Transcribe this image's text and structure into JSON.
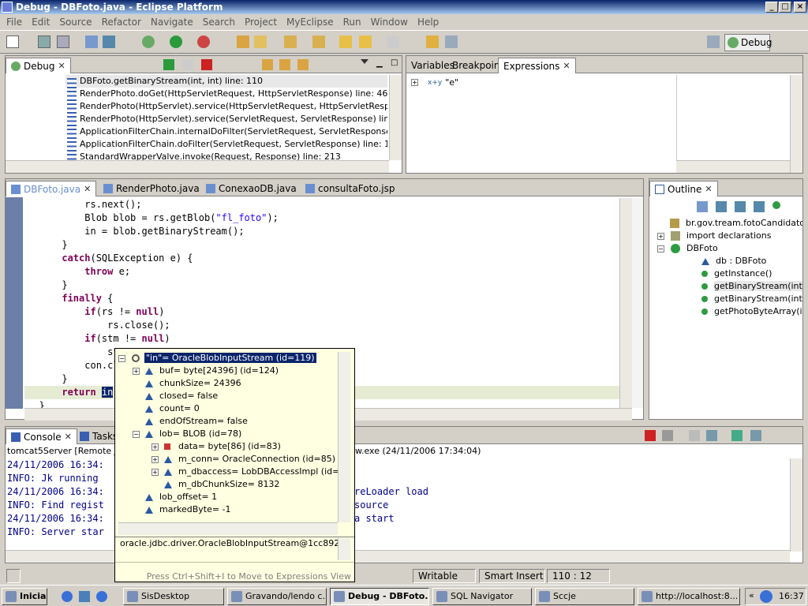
{
  "window": {
    "title": "Debug - DBFoto.java - Eclipse Platform"
  },
  "menu": [
    "File",
    "Edit",
    "Source",
    "Refactor",
    "Navigate",
    "Search",
    "Project",
    "MyEclipse",
    "Run",
    "Window",
    "Help"
  ],
  "perspective": {
    "label": "Debug"
  },
  "debug_view": {
    "tab": "Debug",
    "frames": [
      "DBFoto.getBinaryStream(int, int) line: 110",
      "RenderPhoto.doGet(HttpServletRequest, HttpServletResponse) line: 46",
      "RenderPhoto(HttpServlet).service(HttpServletRequest, HttpServletResponse) line",
      "RenderPhoto(HttpServlet).service(ServletRequest, ServletResponse) line: 802",
      "ApplicationFilterChain.internalDoFilter(ServletRequest, ServletResponse) line: 25",
      "ApplicationFilterChain.doFilter(ServletRequest, ServletResponse) line: 173",
      "StandardWrapperValve.invoke(Request, Response) line: 213"
    ]
  },
  "vars_view": {
    "tabs": [
      "Variables",
      "Breakpoints",
      "Expressions"
    ],
    "expression_icon": "x+y",
    "expression": "\"e\""
  },
  "editor": {
    "tabs": [
      "DBFoto.java",
      "RenderPhoto.java",
      "ConexaoDB.java",
      "consultaFoto.jsp"
    ],
    "lines": [
      {
        "ind": "        ",
        "txt": "rs.next();"
      },
      {
        "ind": "        ",
        "txt": "Blob blob = rs.getBlob(",
        "s": "\"fl_foto\"",
        "after": ");"
      },
      {
        "ind": "        ",
        "txt": "in = blob.getBinaryStream();"
      },
      {
        "ind": "    ",
        "txt": "}"
      },
      {
        "ind": "    ",
        "k": "catch",
        "after": "(SQLException e) {"
      },
      {
        "ind": "        ",
        "k": "throw",
        "after": " e;"
      },
      {
        "ind": "    ",
        "txt": "}"
      },
      {
        "ind": "    ",
        "k": "finally",
        "after": " {"
      },
      {
        "ind": "        ",
        "k": "if",
        "after": "(rs != ",
        "k2": "null",
        "after2": ")"
      },
      {
        "ind": "            ",
        "txt": "rs.close();"
      },
      {
        "ind": "        ",
        "k": "if",
        "after": "(stm != ",
        "k2": "null",
        "after2": ")"
      },
      {
        "ind": "            ",
        "txt": "st"
      },
      {
        "ind": "        ",
        "txt": "con.cl"
      },
      {
        "ind": "    ",
        "txt": "}"
      },
      {
        "ind": "    ",
        "k": "return",
        "after": " ",
        "sel": "in",
        "after2": ";"
      },
      {
        "ind": "",
        "txt": "}"
      }
    ]
  },
  "outline": {
    "tab": "Outline",
    "items": [
      "br.gov.tream.fotoCandidato.",
      "import declarations",
      "DBFoto",
      "db : DBFoto",
      "getInstance()",
      "getBinaryStream(int, int",
      "getBinaryStream(int)",
      "getPhotoByteArray(int,"
    ]
  },
  "popup": {
    "root": "\"in\"= OracleBlobInputStream  (id=119)",
    "rows": [
      "buf= byte[24396]  (id=124)",
      "chunkSize= 24396",
      "closed= false",
      "count= 0",
      "endOfStream= false",
      "lob= BLOB  (id=78)",
      "data= byte[86]  (id=83)",
      "m_conn= OracleConnection  (id=85)",
      "m_dbaccess= LobDBAccessImpl  (id=",
      "m_dbChunkSize= 8132",
      "lob_offset= 1",
      "markedByte= -1"
    ],
    "detail": "oracle.jdbc.driver.OracleBlobInputStream@1cc892e",
    "hint": "Press Ctrl+Shift+I to Move to Expressions View"
  },
  "console": {
    "tabs": [
      "Console",
      "Tasks"
    ],
    "header_left": "tomcat5Server [Remote Java",
    "header_right": "w.exe (24/11/2006 17:34:04)",
    "lines": [
      "24/11/2006 16:34:",
      "INFO: Jk running",
      "24/11/2006 16:34:",
      "INFO: Find regist",
      "24/11/2006 16:34:",
      "INFO: Server star"
    ],
    "right": [
      "",
      "",
      "reLoader load",
      "source",
      "a start",
      ""
    ]
  },
  "status": {
    "writable": "Writable",
    "insert": "Smart Insert",
    "pos": "110 : 12"
  },
  "taskbar": {
    "start": "Iniciar",
    "tasks": [
      "SisDesktop",
      "Gravando/lendo c...",
      "Debug - DBFoto....",
      "SQL Navigator",
      "Sccje",
      "http://localhost:8..."
    ],
    "clock": "16:37"
  }
}
